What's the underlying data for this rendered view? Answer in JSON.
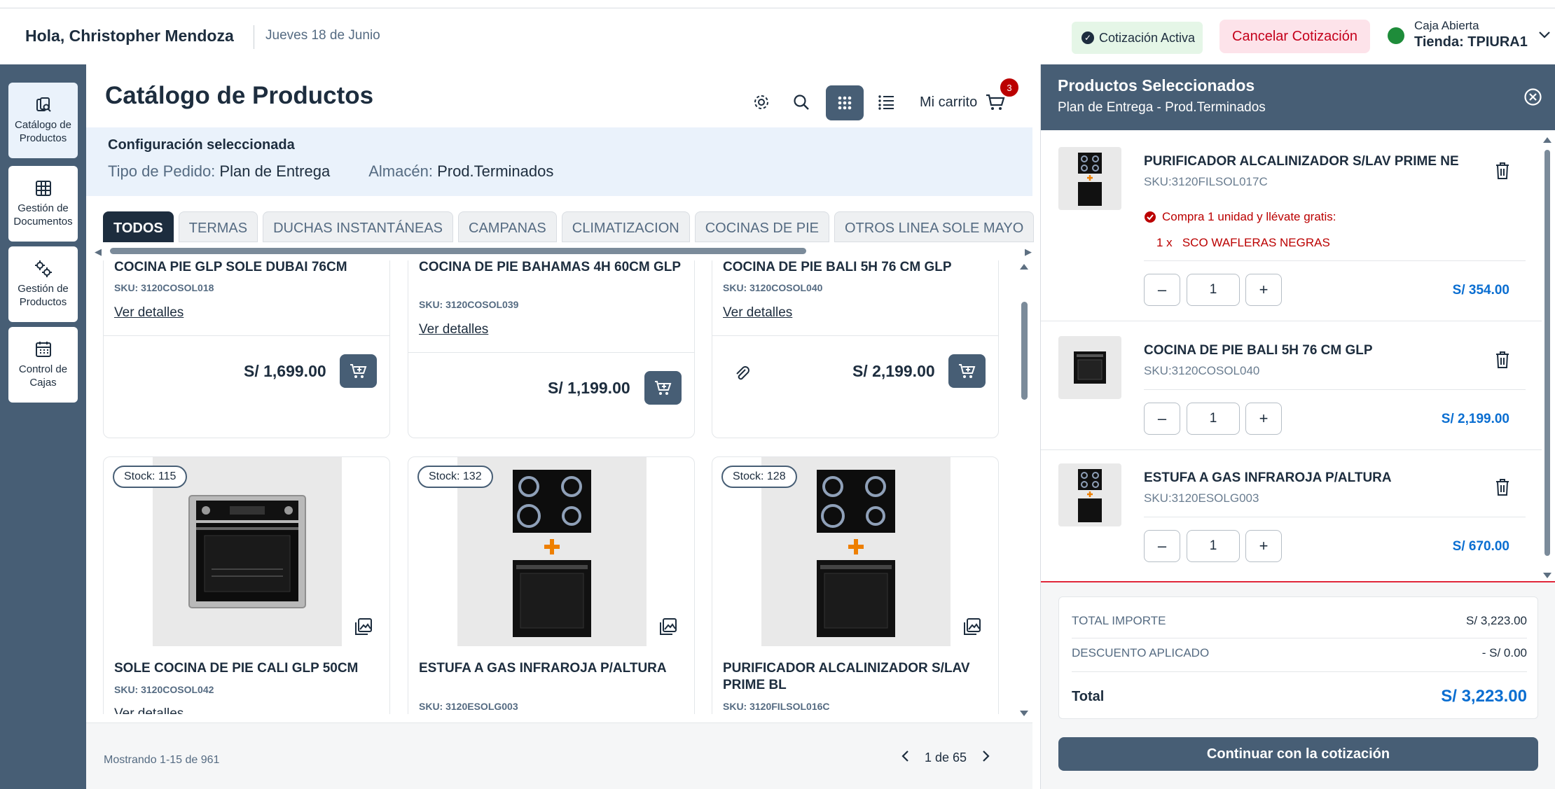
{
  "header": {
    "greeting": "Hola, Christopher Mendoza",
    "date": "Jueves 18 de Junio",
    "quote_status": "Cotización Activa",
    "cancel_label": "Cancelar Cotización",
    "store_status": "Caja Abierta",
    "store_name": "Tienda: TPIURA1"
  },
  "nav": {
    "items": [
      {
        "line1": "Catálogo de",
        "line2": "Productos",
        "icon": "catalog-icon"
      },
      {
        "line1": "Gestión de",
        "line2": "Documentos",
        "icon": "grid-icon"
      },
      {
        "line1": "Gestión de",
        "line2": "Productos",
        "icon": "gears-icon"
      },
      {
        "line1": "Control de",
        "line2": "Cajas",
        "icon": "register-icon"
      }
    ]
  },
  "catalog": {
    "title": "Catálogo de Productos",
    "cart_label": "Mi carrito",
    "cart_count": "3",
    "config_title": "Configuración seleccionada",
    "order_type_label": "Tipo de Pedido:",
    "order_type_value": "Plan de Entrega",
    "warehouse_label": "Almacén:",
    "warehouse_value": "Prod.Terminados",
    "tabs": [
      "TODOS",
      "TERMAS",
      "DUCHAS INSTANTÁNEAS",
      "CAMPANAS",
      "CLIMATIZACION",
      "COCINAS DE PIE",
      "OTROS LINEA SOLE MAYO"
    ],
    "details_label": "Ver detalles",
    "row1": [
      {
        "name": "COCINA PIE GLP SOLE DUBAI 76CM",
        "sku": "SKU: 3120COSOL018",
        "price": "S/ 1,699.00"
      },
      {
        "name": "COCINA DE PIE BAHAMAS 4H 60CM GLP",
        "sku": "SKU: 3120COSOL039",
        "price": "S/ 1,199.00"
      },
      {
        "name": "COCINA DE PIE BALI 5H 76 CM GLP",
        "sku": "SKU: 3120COSOL040",
        "price": "S/ 2,199.00"
      }
    ],
    "row2": [
      {
        "stock": "Stock: 115",
        "name": "SOLE COCINA DE PIE CALI GLP 50CM",
        "sku": "SKU: 3120COSOL042"
      },
      {
        "stock": "Stock: 132",
        "name": "ESTUFA A GAS INFRAROJA P/ALTURA",
        "sku": "SKU: 3120ESOLG003"
      },
      {
        "stock": "Stock: 128",
        "name": "PURIFICADOR ALCALINIZADOR S/LAV PRIME BL",
        "sku": "SKU: 3120FILSOL016C"
      }
    ],
    "showing": "Mostrando 1-15 de 961",
    "page": "1 de 65"
  },
  "cart": {
    "title": "Productos Seleccionados",
    "subtitle": "Plan de Entrega - Prod.Terminados",
    "items": [
      {
        "name": "PURIFICADOR ALCALINIZADOR S/LAV PRIME NE",
        "sku": "SKU:3120FILSOL017C",
        "promo": "Compra 1 unidad y llévate gratis:",
        "promo_item": "1 x   SCO WAFLERAS NEGRAS",
        "qty": "1",
        "price": "S/ 354.00"
      },
      {
        "name": "COCINA DE PIE BALI 5H 76 CM GLP",
        "sku": "SKU:3120COSOL040",
        "qty": "1",
        "price": "S/ 2,199.00"
      },
      {
        "name": "ESTUFA A GAS INFRAROJA P/ALTURA",
        "sku": "SKU:3120ESOLG003",
        "qty": "1",
        "price": "S/ 670.00"
      }
    ],
    "total_import_label": "TOTAL IMPORTE",
    "total_import_value": "S/ 3,223.00",
    "discount_label": "DESCUENTO APLICADO",
    "discount_value": "- S/ 0.00",
    "total_label": "Total",
    "total_value": "S/ 3,223.00",
    "continue_label": "Continuar con la cotización",
    "qty_minus": "–",
    "qty_plus": "+"
  },
  "colors": {
    "primary": "#475e75",
    "accent": "#0a6ed1",
    "danger": "#bb0000",
    "text": "#1d2d3e"
  }
}
